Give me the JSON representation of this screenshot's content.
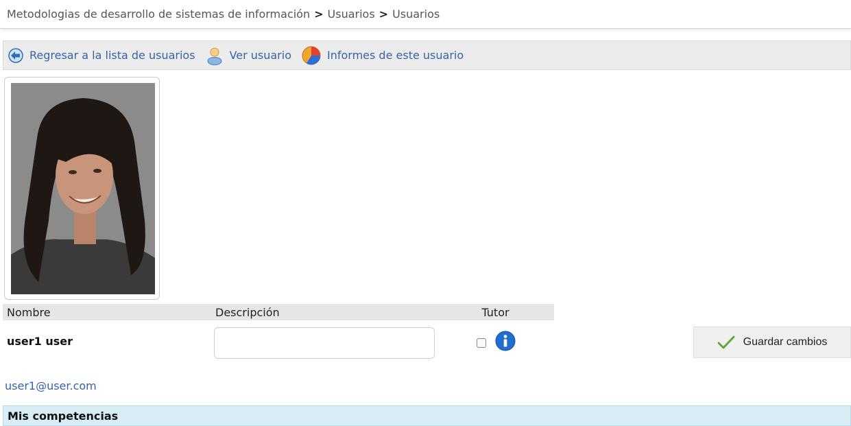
{
  "breadcrumb": {
    "items": [
      "Metodologias de desarrollo de sistemas de información",
      "Usuarios",
      "Usuarios"
    ],
    "separator": ">"
  },
  "toolbar": {
    "back_label": "Regresar a la lista de usuarios",
    "view_label": "Ver usuario",
    "reports_label": "Informes de este usuario"
  },
  "table": {
    "headers": {
      "name": "Nombre",
      "description": "Descripción",
      "tutor": "Tutor"
    },
    "row": {
      "name": "user1 user",
      "description_value": "",
      "tutor_checked": false
    }
  },
  "actions": {
    "save_label": "Guardar cambios"
  },
  "user": {
    "email": "user1@user.com"
  },
  "section": {
    "title": "Mis competencias"
  },
  "colors": {
    "link": "#3464a8",
    "section_bg": "#d9edf6",
    "toolbar_bg": "#ececec"
  }
}
